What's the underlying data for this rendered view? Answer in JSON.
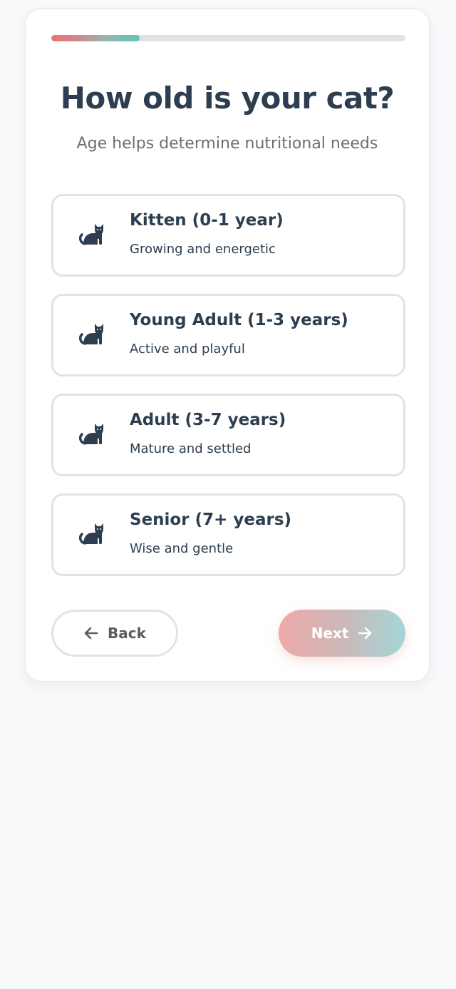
{
  "progress": {
    "fraction": 0.25
  },
  "question": {
    "title": "How old is your cat?",
    "subtitle": "Age helps determine nutritional needs"
  },
  "options": [
    {
      "label": "Kitten (0-1 year)",
      "description": "Growing and energetic",
      "icon": "cat-icon"
    },
    {
      "label": "Young Adult (1-3 years)",
      "description": "Active and playful",
      "icon": "cat-icon"
    },
    {
      "label": "Adult (3-7 years)",
      "description": "Mature and settled",
      "icon": "cat-icon"
    },
    {
      "label": "Senior (7+ years)",
      "description": "Wise and gentle",
      "icon": "cat-icon"
    }
  ],
  "navigation": {
    "back_label": "Back",
    "back_icon": "arrow-left-icon",
    "next_label": "Next",
    "next_icon": "arrow-right-icon"
  },
  "colors": {
    "text_primary": "#2d3e50",
    "text_secondary": "#6a6f76",
    "progress_start": "#e57373",
    "progress_end": "#5fc4ba",
    "next_gradient_start": "#edaaa8",
    "next_gradient_end": "#a4d6d8"
  }
}
